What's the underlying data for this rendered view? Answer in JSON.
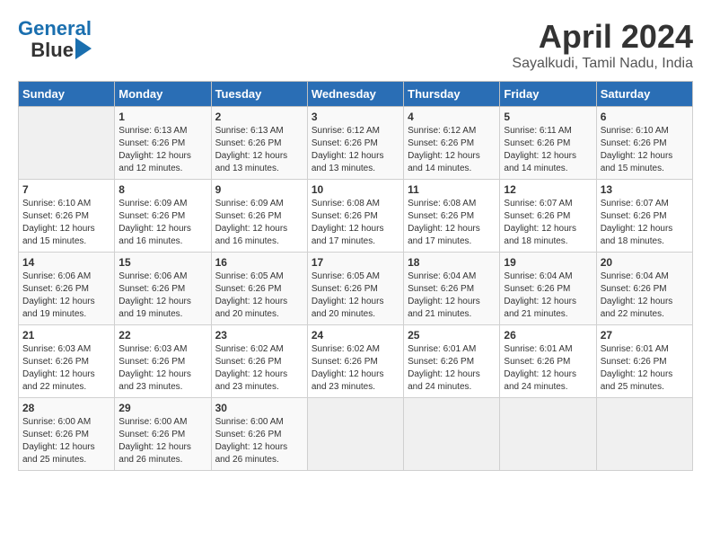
{
  "logo": {
    "line1": "General",
    "line2": "Blue"
  },
  "title": "April 2024",
  "subtitle": "Sayalkudi, Tamil Nadu, India",
  "weekdays": [
    "Sunday",
    "Monday",
    "Tuesday",
    "Wednesday",
    "Thursday",
    "Friday",
    "Saturday"
  ],
  "weeks": [
    [
      {
        "day": "",
        "info": ""
      },
      {
        "day": "1",
        "info": "Sunrise: 6:13 AM\nSunset: 6:26 PM\nDaylight: 12 hours\nand 12 minutes."
      },
      {
        "day": "2",
        "info": "Sunrise: 6:13 AM\nSunset: 6:26 PM\nDaylight: 12 hours\nand 13 minutes."
      },
      {
        "day": "3",
        "info": "Sunrise: 6:12 AM\nSunset: 6:26 PM\nDaylight: 12 hours\nand 13 minutes."
      },
      {
        "day": "4",
        "info": "Sunrise: 6:12 AM\nSunset: 6:26 PM\nDaylight: 12 hours\nand 14 minutes."
      },
      {
        "day": "5",
        "info": "Sunrise: 6:11 AM\nSunset: 6:26 PM\nDaylight: 12 hours\nand 14 minutes."
      },
      {
        "day": "6",
        "info": "Sunrise: 6:10 AM\nSunset: 6:26 PM\nDaylight: 12 hours\nand 15 minutes."
      }
    ],
    [
      {
        "day": "7",
        "info": "Sunrise: 6:10 AM\nSunset: 6:26 PM\nDaylight: 12 hours\nand 15 minutes."
      },
      {
        "day": "8",
        "info": "Sunrise: 6:09 AM\nSunset: 6:26 PM\nDaylight: 12 hours\nand 16 minutes."
      },
      {
        "day": "9",
        "info": "Sunrise: 6:09 AM\nSunset: 6:26 PM\nDaylight: 12 hours\nand 16 minutes."
      },
      {
        "day": "10",
        "info": "Sunrise: 6:08 AM\nSunset: 6:26 PM\nDaylight: 12 hours\nand 17 minutes."
      },
      {
        "day": "11",
        "info": "Sunrise: 6:08 AM\nSunset: 6:26 PM\nDaylight: 12 hours\nand 17 minutes."
      },
      {
        "day": "12",
        "info": "Sunrise: 6:07 AM\nSunset: 6:26 PM\nDaylight: 12 hours\nand 18 minutes."
      },
      {
        "day": "13",
        "info": "Sunrise: 6:07 AM\nSunset: 6:26 PM\nDaylight: 12 hours\nand 18 minutes."
      }
    ],
    [
      {
        "day": "14",
        "info": "Sunrise: 6:06 AM\nSunset: 6:26 PM\nDaylight: 12 hours\nand 19 minutes."
      },
      {
        "day": "15",
        "info": "Sunrise: 6:06 AM\nSunset: 6:26 PM\nDaylight: 12 hours\nand 19 minutes."
      },
      {
        "day": "16",
        "info": "Sunrise: 6:05 AM\nSunset: 6:26 PM\nDaylight: 12 hours\nand 20 minutes."
      },
      {
        "day": "17",
        "info": "Sunrise: 6:05 AM\nSunset: 6:26 PM\nDaylight: 12 hours\nand 20 minutes."
      },
      {
        "day": "18",
        "info": "Sunrise: 6:04 AM\nSunset: 6:26 PM\nDaylight: 12 hours\nand 21 minutes."
      },
      {
        "day": "19",
        "info": "Sunrise: 6:04 AM\nSunset: 6:26 PM\nDaylight: 12 hours\nand 21 minutes."
      },
      {
        "day": "20",
        "info": "Sunrise: 6:04 AM\nSunset: 6:26 PM\nDaylight: 12 hours\nand 22 minutes."
      }
    ],
    [
      {
        "day": "21",
        "info": "Sunrise: 6:03 AM\nSunset: 6:26 PM\nDaylight: 12 hours\nand 22 minutes."
      },
      {
        "day": "22",
        "info": "Sunrise: 6:03 AM\nSunset: 6:26 PM\nDaylight: 12 hours\nand 23 minutes."
      },
      {
        "day": "23",
        "info": "Sunrise: 6:02 AM\nSunset: 6:26 PM\nDaylight: 12 hours\nand 23 minutes."
      },
      {
        "day": "24",
        "info": "Sunrise: 6:02 AM\nSunset: 6:26 PM\nDaylight: 12 hours\nand 23 minutes."
      },
      {
        "day": "25",
        "info": "Sunrise: 6:01 AM\nSunset: 6:26 PM\nDaylight: 12 hours\nand 24 minutes."
      },
      {
        "day": "26",
        "info": "Sunrise: 6:01 AM\nSunset: 6:26 PM\nDaylight: 12 hours\nand 24 minutes."
      },
      {
        "day": "27",
        "info": "Sunrise: 6:01 AM\nSunset: 6:26 PM\nDaylight: 12 hours\nand 25 minutes."
      }
    ],
    [
      {
        "day": "28",
        "info": "Sunrise: 6:00 AM\nSunset: 6:26 PM\nDaylight: 12 hours\nand 25 minutes."
      },
      {
        "day": "29",
        "info": "Sunrise: 6:00 AM\nSunset: 6:26 PM\nDaylight: 12 hours\nand 26 minutes."
      },
      {
        "day": "30",
        "info": "Sunrise: 6:00 AM\nSunset: 6:26 PM\nDaylight: 12 hours\nand 26 minutes."
      },
      {
        "day": "",
        "info": ""
      },
      {
        "day": "",
        "info": ""
      },
      {
        "day": "",
        "info": ""
      },
      {
        "day": "",
        "info": ""
      }
    ]
  ]
}
